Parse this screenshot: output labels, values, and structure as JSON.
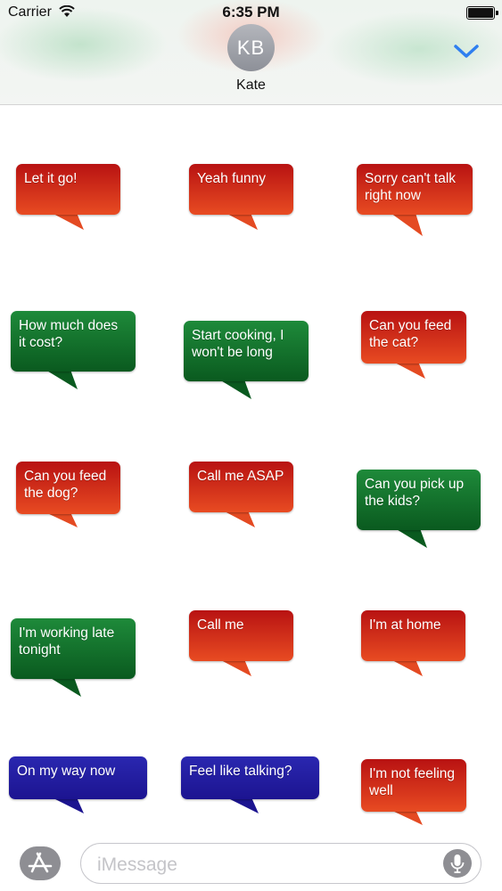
{
  "status_bar": {
    "carrier": "Carrier",
    "time": "6:35 PM"
  },
  "contact": {
    "initials": "KB",
    "name": "Kate"
  },
  "colors": {
    "accent": "#2f7ff0",
    "red_top": "#b81212",
    "red_bottom": "#e84b22",
    "green_top": "#1e8a3a",
    "green_bottom": "#0a5a1f",
    "blue": "#2a27b0"
  },
  "stickers": [
    {
      "text": "Let it go!",
      "color": "red"
    },
    {
      "text": "Yeah funny",
      "color": "red"
    },
    {
      "text": "Sorry can't talk right now",
      "color": "red"
    },
    {
      "text": "How much does it cost?",
      "color": "green"
    },
    {
      "text": "Start cooking, I won't be long",
      "color": "green"
    },
    {
      "text": "Can you feed the cat?",
      "color": "red"
    },
    {
      "text": "Can you feed the dog?",
      "color": "red"
    },
    {
      "text": "Call me ASAP",
      "color": "red"
    },
    {
      "text": "Can you pick up the kids?",
      "color": "green"
    },
    {
      "text": "I'm working late tonight",
      "color": "green"
    },
    {
      "text": "Call me",
      "color": "red"
    },
    {
      "text": "I'm at home",
      "color": "red"
    },
    {
      "text": "On my way now",
      "color": "blue"
    },
    {
      "text": "Feel like talking?",
      "color": "blue"
    },
    {
      "text": "I'm not feeling well",
      "color": "red"
    }
  ],
  "input_bar": {
    "placeholder": "iMessage"
  },
  "icons": {
    "appstore": "app-store-icon",
    "mic": "microphone-icon",
    "collapse": "chevron-down-icon",
    "wifi": "wifi-icon",
    "battery": "battery-icon"
  }
}
